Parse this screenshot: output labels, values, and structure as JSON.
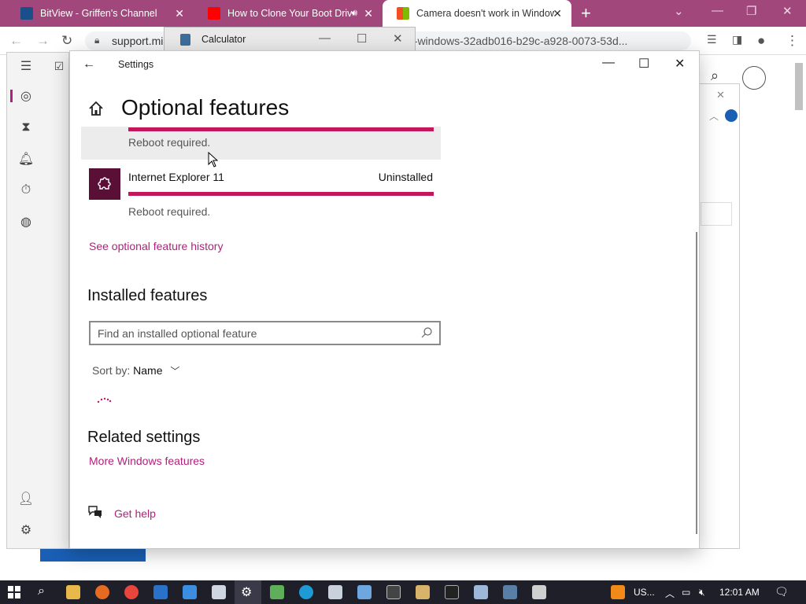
{
  "browser": {
    "tabs": [
      {
        "title": "BitView - Griffen's Channel",
        "active": false,
        "favicon_color": "#1b4f8a"
      },
      {
        "title": "How to Clone Your Boot Drive",
        "active": false,
        "favicon_color": "#ff0000",
        "audio": true
      },
      {
        "title": "Camera doesn't work in Windows",
        "active": true,
        "favicon_color": "#f25022"
      }
    ],
    "url_start": "support.mi",
    "url_end": "n-windows-32adb016-b29c-a928-0073-53d..."
  },
  "calculator": {
    "title": "Calculator"
  },
  "settings": {
    "window_title": "Settings",
    "page_title": "Optional features",
    "features": [
      {
        "name": "",
        "status": "",
        "note": "Reboot required.",
        "hover": true,
        "progress": 1.0
      },
      {
        "name": "Internet Explorer 11",
        "status": "Uninstalled",
        "note": "Reboot required.",
        "hover": false,
        "progress": 1.0
      }
    ],
    "history_link": "See optional feature history",
    "installed_heading": "Installed features",
    "search_placeholder": "Find an installed optional feature",
    "sort_label": "Sort by:",
    "sort_value": "Name",
    "related_heading": "Related settings",
    "more_features_link": "More Windows features",
    "get_help": "Get help"
  },
  "taskbar": {
    "language": "US...",
    "time": "12:01 AM"
  },
  "colors": {
    "accent": "#b0217b",
    "tab_bar": "#a2477b",
    "progress": "#c2185b",
    "feature_icon_bg": "#5a1036"
  }
}
